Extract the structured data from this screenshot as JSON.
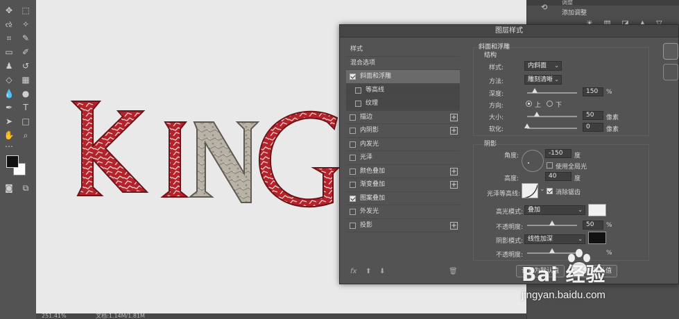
{
  "dialog": {
    "title": "图层样式",
    "style_list": [
      {
        "label": "样式",
        "kind": "header"
      },
      {
        "label": "混合选项",
        "kind": "header"
      },
      {
        "label": "斜面和浮雕",
        "checked": true,
        "selected": true
      },
      {
        "label": "等高线",
        "checked": false,
        "sub": true
      },
      {
        "label": "纹理",
        "checked": false,
        "sub": true
      },
      {
        "label": "描边",
        "checked": false,
        "plus": true
      },
      {
        "label": "内阴影",
        "checked": false,
        "plus": true
      },
      {
        "label": "内发光",
        "checked": false
      },
      {
        "label": "光泽",
        "checked": false
      },
      {
        "label": "颜色叠加",
        "checked": false,
        "plus": true
      },
      {
        "label": "渐变叠加",
        "checked": false,
        "plus": true
      },
      {
        "label": "图案叠加",
        "checked": true
      },
      {
        "label": "外发光",
        "checked": false
      },
      {
        "label": "投影",
        "checked": false,
        "plus": true
      }
    ],
    "footer": {
      "fx": "fx",
      "up": "⬆",
      "down": "⬇",
      "trash": "🗑"
    },
    "bevel": {
      "section_title": "斜面和浮雕",
      "structure_title": "结构",
      "style_label": "样式:",
      "style_value": "内斜面",
      "technique_label": "方法:",
      "technique_value": "雕刻清晰",
      "depth_label": "深度:",
      "depth_value": "150",
      "depth_unit": "%",
      "depth_level": 0.15,
      "direction_label": "方向:",
      "direction_up": "上",
      "direction_down": "下",
      "size_label": "大小:",
      "size_value": "50",
      "size_unit": "像素",
      "size_level": 0.2,
      "soften_label": "软化:",
      "soften_value": "0",
      "soften_unit": "像素",
      "soften_level": 0.0
    },
    "shading": {
      "section_title": "阴影",
      "angle_label": "角度:",
      "angle_value": "-150",
      "angle_unit": "度",
      "global_light_label": "使用全局光",
      "global_light_checked": false,
      "altitude_label": "高度:",
      "altitude_value": "40",
      "altitude_unit": "度",
      "gloss_contour_label": "光泽等高线:",
      "anti_alias_label": "消除锯齿",
      "anti_alias_checked": true,
      "highlight_mode_label": "高光模式:",
      "highlight_mode_value": "叠加",
      "highlight_color": "#f2f2f2",
      "highlight_opacity_label": "不透明度:",
      "highlight_opacity_value": "50",
      "highlight_opacity_unit": "%",
      "highlight_opacity_level": 0.5,
      "shadow_mode_label": "阴影模式:",
      "shadow_mode_value": "线性加深",
      "shadow_color": "#111111",
      "shadow_opacity_label": "不透明度:",
      "shadow_opacity_unit": "%",
      "shadow_opacity_level": 0.5
    },
    "buttons": {
      "set_default": "设置为默认值",
      "reset_default": "复位为默认值"
    }
  },
  "right_panel": {
    "tab_label": "调整",
    "add_adjustment": "添加调整"
  },
  "status": {
    "zoom": "251.41%",
    "doc": "文档:1.14M/1.81M"
  },
  "canvas": {
    "artwork_text": "KING"
  },
  "watermark": {
    "logo": "Bai  经验",
    "url": "jingyan.baidu.com"
  },
  "colors": {
    "ps_bg": "#535353",
    "canvas_bg": "#e9e9e9",
    "text_red": "#b4232c",
    "text_stone": "#b9b3a7"
  }
}
